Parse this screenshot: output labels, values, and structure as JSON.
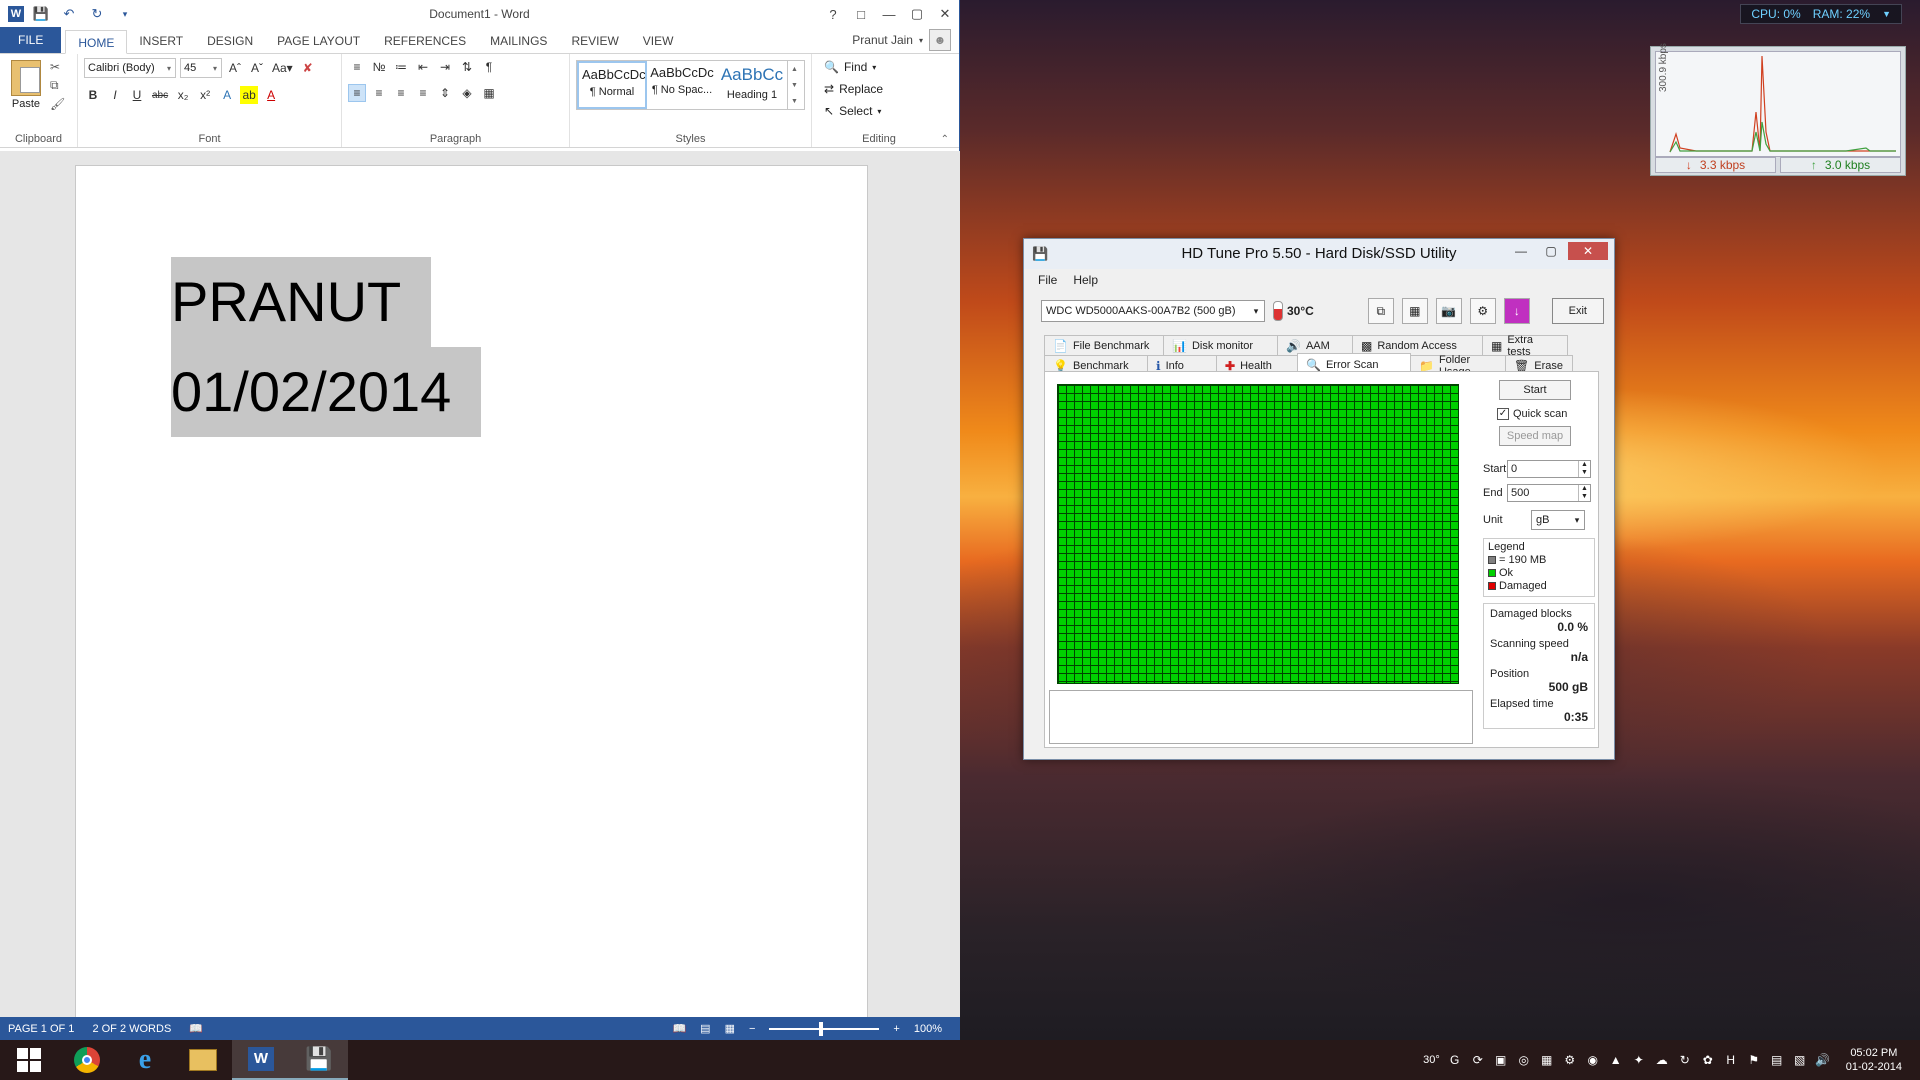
{
  "word": {
    "doc_title": "Document1 - Word",
    "tabs": [
      "FILE",
      "HOME",
      "INSERT",
      "DESIGN",
      "PAGE LAYOUT",
      "REFERENCES",
      "MAILINGS",
      "REVIEW",
      "VIEW"
    ],
    "user": "Pranut Jain",
    "font_name": "Calibri (Body)",
    "font_size": "45",
    "paste_label": "Paste",
    "groups": [
      "Clipboard",
      "Font",
      "Paragraph",
      "Styles",
      "Editing"
    ],
    "styles": [
      {
        "preview": "AaBbCcDc",
        "name": "¶ Normal"
      },
      {
        "preview": "AaBbCcDc",
        "name": "¶ No Spac..."
      },
      {
        "preview": "AaBbCc",
        "name": "Heading 1"
      }
    ],
    "editing": [
      "Find",
      "Replace",
      "Select"
    ],
    "doc_lines": [
      "PRANUT",
      "01/02/2014"
    ],
    "status": {
      "page": "PAGE 1 OF 1",
      "words": "2 OF 2 WORDS",
      "zoom": "100%"
    }
  },
  "sysmon": {
    "cpu": "CPU: 0%",
    "ram": "RAM: 22%"
  },
  "network": {
    "ylabel": "300.9 kbps",
    "down": "3.3 kbps",
    "up": "3.0 kbps"
  },
  "hdtune": {
    "title": "HD Tune Pro 5.50 - Hard Disk/SSD Utility",
    "menu": [
      "File",
      "Help"
    ],
    "drive": "WDC WD5000AAKS-00A7B2 (500 gB)",
    "temperature": "30°C",
    "exit_label": "Exit",
    "tabs_row1": [
      "File Benchmark",
      "Disk monitor",
      "AAM",
      "Random Access",
      "Extra tests"
    ],
    "tabs_row2": [
      "Benchmark",
      "Info",
      "Health",
      "Error Scan",
      "Folder Usage",
      "Erase"
    ],
    "start_button": "Start",
    "quick_scan": "Quick scan",
    "speed_map": "Speed map",
    "start_label": "Start",
    "start_value": "0",
    "end_label": "End",
    "end_value": "500",
    "unit_label": "Unit",
    "unit_value": "gB",
    "legend_title": "Legend",
    "legend": [
      {
        "label": "= 190 MB",
        "color": "#808080"
      },
      {
        "label": "Ok",
        "color": "#00d000"
      },
      {
        "label": "Damaged",
        "color": "#e00000"
      }
    ],
    "damaged_blocks_label": "Damaged blocks",
    "damaged_blocks_value": "0.0 %",
    "scanning_speed_label": "Scanning speed",
    "scanning_speed_value": "n/a",
    "position_label": "Position",
    "position_value": "500 gB",
    "elapsed_label": "Elapsed time",
    "elapsed_value": "0:35"
  },
  "taskbar": {
    "apps": [
      "start-button",
      "chrome-icon",
      "internet-explorer-icon",
      "file-explorer-icon",
      "word-icon",
      "hdtune-icon"
    ],
    "tray_temp": "30°",
    "time": "05:02 PM",
    "date": "01-02-2014"
  },
  "colors": {
    "word_accent": "#2b579a",
    "scan_ok": "#00d000",
    "scan_damaged": "#e00000"
  }
}
